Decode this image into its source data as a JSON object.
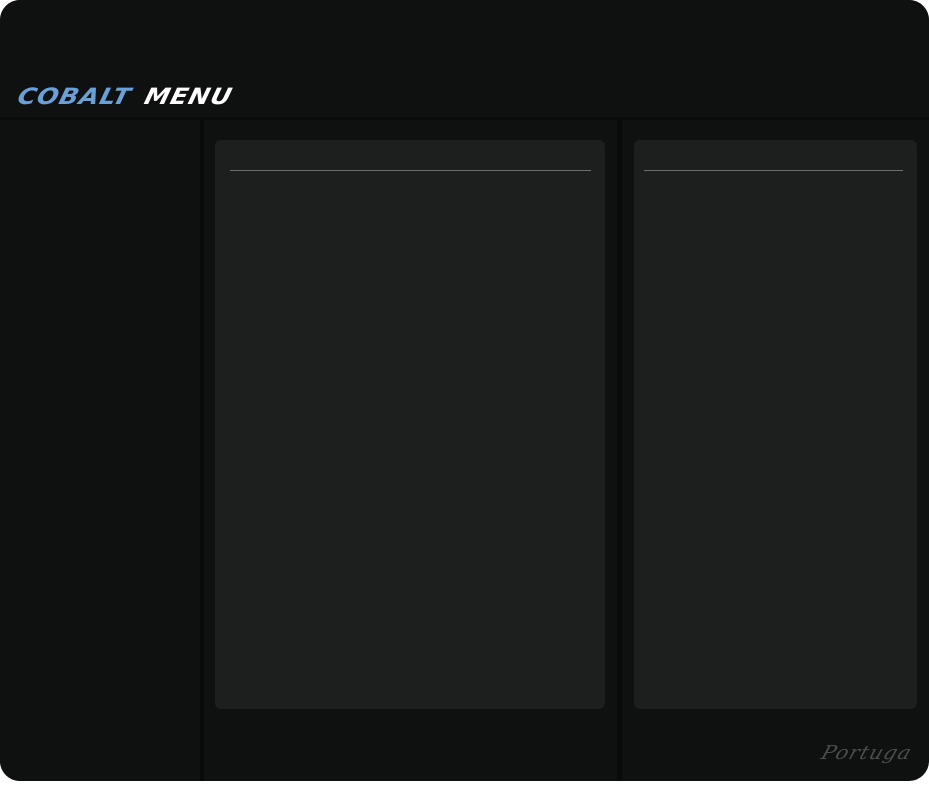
{
  "app": {
    "logo_part_1": "COBALT",
    "logo_part_2": "MENU",
    "accent_color": "#6a9fd8",
    "watermark": "Portuga"
  },
  "panels": {
    "left": {
      "title": ""
    },
    "right": {
      "title": ""
    }
  },
  "sidebar": {
    "items": []
  }
}
